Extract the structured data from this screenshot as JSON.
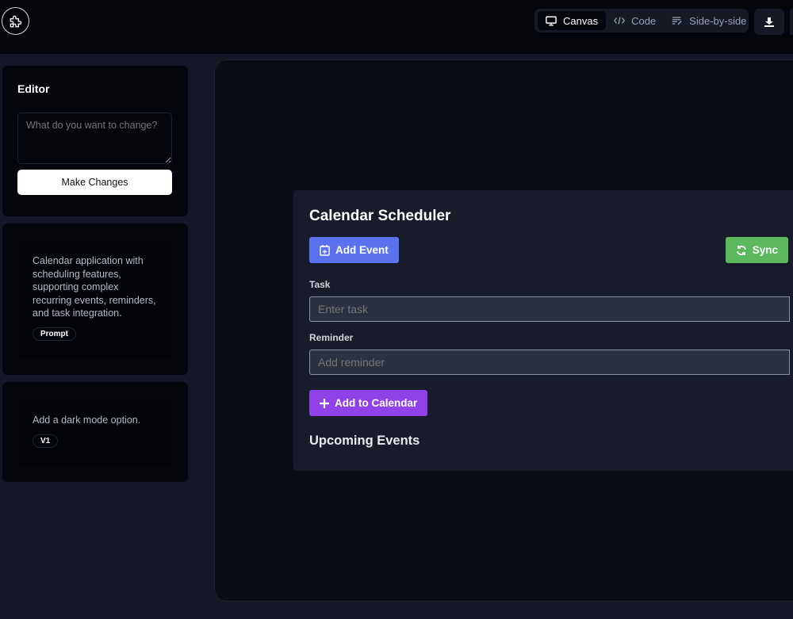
{
  "header": {
    "logo_icon": "puzzle-icon",
    "tabs": [
      {
        "label": "Canvas",
        "icon": "monitor-icon",
        "active": true
      },
      {
        "label": "Code",
        "icon": "code-icon"
      },
      {
        "label": "Side-by-side",
        "icon": "side-by-side-icon"
      }
    ],
    "download_icon": "download-icon"
  },
  "editor": {
    "title": "Editor",
    "placeholder": "What do you want to change?",
    "button": "Make Changes"
  },
  "history": [
    {
      "text": "Calendar application with scheduling features, supporting complex recurring events, reminders, and task integration.",
      "badge": "Prompt"
    },
    {
      "text": "Add a dark mode option.",
      "badge": "V1"
    }
  ],
  "app": {
    "title": "Calendar Scheduler",
    "add_event": "Add Event",
    "sync": "Sync",
    "task_label": "Task",
    "task_placeholder": "Enter task",
    "reminder_label": "Reminder",
    "reminder_placeholder": "Add reminder",
    "add_to_calendar": "Add to Calendar",
    "upcoming": "Upcoming Events",
    "colors": {
      "add_event": "#5b72ee",
      "sync": "#5cb85c",
      "add_to_calendar": "#9141e8"
    }
  }
}
